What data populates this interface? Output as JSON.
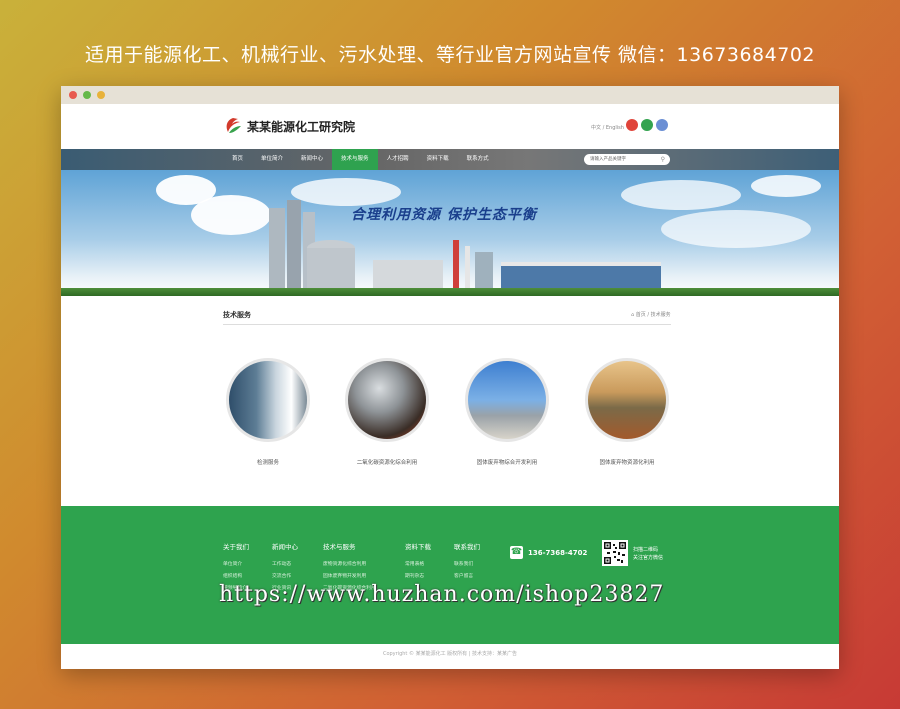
{
  "promo": {
    "text": "适用于能源化工、机械行业、污水处理、等行业官方网站宣传  微信：13673684702"
  },
  "window": {
    "dots": [
      "#e85a4f",
      "#e8b23a",
      "#66b94a"
    ]
  },
  "header": {
    "logo_text": "某某能源化工研究院",
    "lang": "中文 / English",
    "circle_colors": [
      "#e0443a",
      "#33a34f",
      "#6b8fd4"
    ]
  },
  "nav": {
    "items": [
      "首页",
      "单位简介",
      "新闻中心",
      "技术与服务",
      "人才招聘",
      "资料下载",
      "联系方式"
    ],
    "active_index": 3,
    "search_placeholder": "请输入产品关键字",
    "active_color": "#2fa24f"
  },
  "banner": {
    "slogan": "合理利用资源 保护生态平衡"
  },
  "section": {
    "title": "技术服务",
    "breadcrumb": "首页 / 技术服务",
    "services": [
      {
        "label": "检测服务",
        "icon": "lab-photo"
      },
      {
        "label": "二氧化碳资源化综合利用",
        "icon": "smokestack-photo"
      },
      {
        "label": "固体废弃物综合开发利用",
        "icon": "factory-photo"
      },
      {
        "label": "固体废弃物资源化利用",
        "icon": "waste-photo"
      }
    ]
  },
  "footer": {
    "columns": [
      {
        "title": "关于我们",
        "links": [
          "单位简介",
          "组织结构",
          "院领导简介"
        ]
      },
      {
        "title": "新闻中心",
        "links": [
          "工作动态",
          "交流合作",
          "行业资讯"
        ]
      },
      {
        "title": "技术与服务",
        "links": [
          "废物资源化综合利用",
          "固体废弃物开发利用",
          "二氧化碳资源化综合利用"
        ]
      },
      {
        "title": "资料下载",
        "links": [
          "常用表格",
          "期刊杂志"
        ]
      },
      {
        "title": "联系我们",
        "links": [
          "联系我们",
          "客户留言"
        ]
      }
    ],
    "phone": "136-7368-4702",
    "qr_caption_1": "扫描二维码",
    "qr_caption_2": "关注官方微信",
    "copyright": "Copyright © 某某能源化工 版权所有 | 技术支持：某某广告"
  },
  "watermark": "https://www.huzhan.com/ishop23827"
}
